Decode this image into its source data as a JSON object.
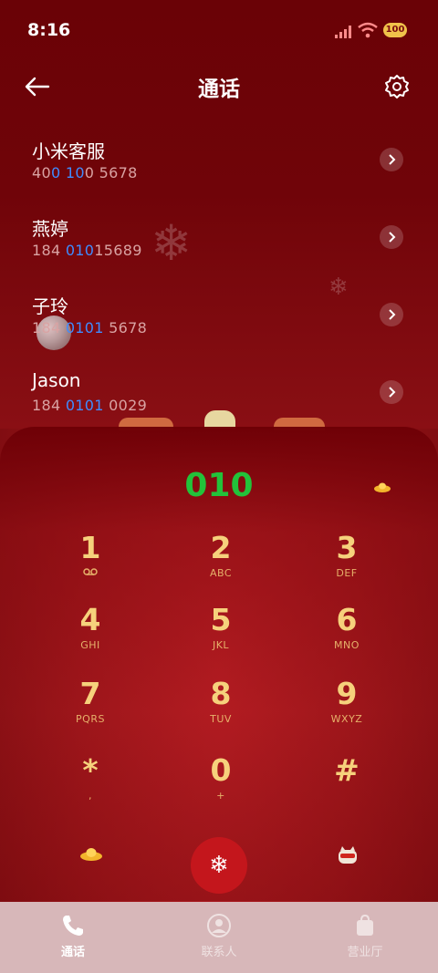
{
  "status": {
    "time": "8:16",
    "battery": "100"
  },
  "header": {
    "title": "通话"
  },
  "recents": [
    {
      "name": "小米客服",
      "num_a": "40",
      "num_b": "0 10",
      "num_c": "0 5678"
    },
    {
      "name": "燕婷",
      "num_a": "184 ",
      "num_b": "010",
      "num_c": "15689"
    },
    {
      "name": "子玲",
      "num_a": "184 ",
      "num_b": "0101",
      "num_c": " 5678"
    },
    {
      "name": "Jason",
      "num_a": "184 ",
      "num_b": "0101",
      "num_c": " 0029"
    }
  ],
  "dialer": {
    "display": "010",
    "keys": [
      {
        "digit": "1",
        "letters": ""
      },
      {
        "digit": "2",
        "letters": "ABC"
      },
      {
        "digit": "3",
        "letters": "DEF"
      },
      {
        "digit": "4",
        "letters": "GHI"
      },
      {
        "digit": "5",
        "letters": "JKL"
      },
      {
        "digit": "6",
        "letters": "MNO"
      },
      {
        "digit": "7",
        "letters": "PQRS"
      },
      {
        "digit": "8",
        "letters": "TUV"
      },
      {
        "digit": "9",
        "letters": "WXYZ"
      },
      {
        "digit": "*",
        "letters": ","
      },
      {
        "digit": "0",
        "letters": "+"
      },
      {
        "digit": "#",
        "letters": ""
      }
    ]
  },
  "tabs": [
    {
      "label": "通话",
      "icon": "phone-icon",
      "color": "#ffffff"
    },
    {
      "label": "联系人",
      "icon": "person-icon",
      "color": "#efe2e2"
    },
    {
      "label": "营业厅",
      "icon": "bag-icon",
      "color": "#efe2e2"
    }
  ],
  "colors": {
    "accent_green": "#23c23a",
    "highlight_blue": "#3f8cff",
    "call_button": "#c4161c",
    "key_gold": "#f6d17c"
  }
}
